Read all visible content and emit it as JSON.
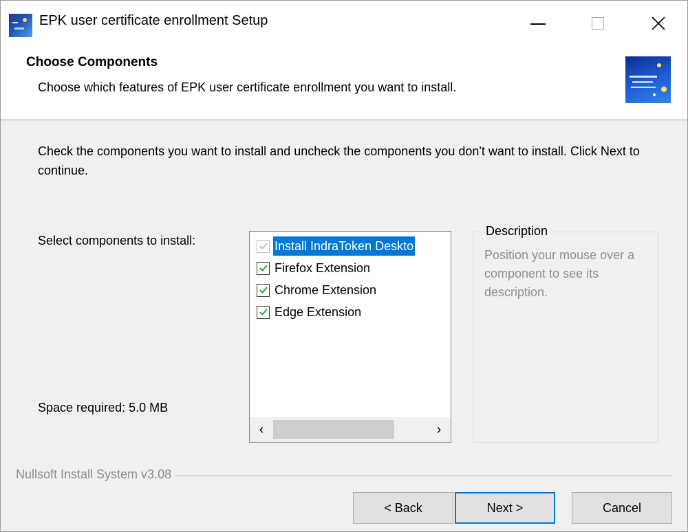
{
  "window": {
    "title": "EPK user certificate enrollment Setup",
    "app_icon": "installer-app-icon"
  },
  "header": {
    "title": "Choose Components",
    "subtitle": "Choose which features of EPK user certificate enrollment you want to install.",
    "logo": "installer-logo"
  },
  "body": {
    "instructions": "Check the components you want to install and uncheck the components you don't want to install. Click Next to continue.",
    "select_label": "Select components to install:",
    "space_required": "Space required: 5.0 MB"
  },
  "components": [
    {
      "label": "Install IndraToken Deskto",
      "checked": true,
      "disabled": true,
      "selected": true
    },
    {
      "label": "Firefox Extension",
      "checked": true,
      "disabled": false,
      "selected": false
    },
    {
      "label": "Chrome Extension",
      "checked": true,
      "disabled": false,
      "selected": false
    },
    {
      "label": "Edge Extension",
      "checked": true,
      "disabled": false,
      "selected": false
    }
  ],
  "scrollbar": {
    "left_arrow": "‹",
    "right_arrow": "›"
  },
  "description": {
    "legend": "Description",
    "text": "Position your mouse over a component to see its description."
  },
  "footer": {
    "branding": "Nullsoft Install System v3.08",
    "back_label": "< Back",
    "next_label": "Next >",
    "cancel_label": "Cancel"
  },
  "colors": {
    "selection": "#0078d7",
    "check": "#2a9d3a",
    "check_disabled": "#c0c0c0",
    "background": "#f0f0f0"
  }
}
